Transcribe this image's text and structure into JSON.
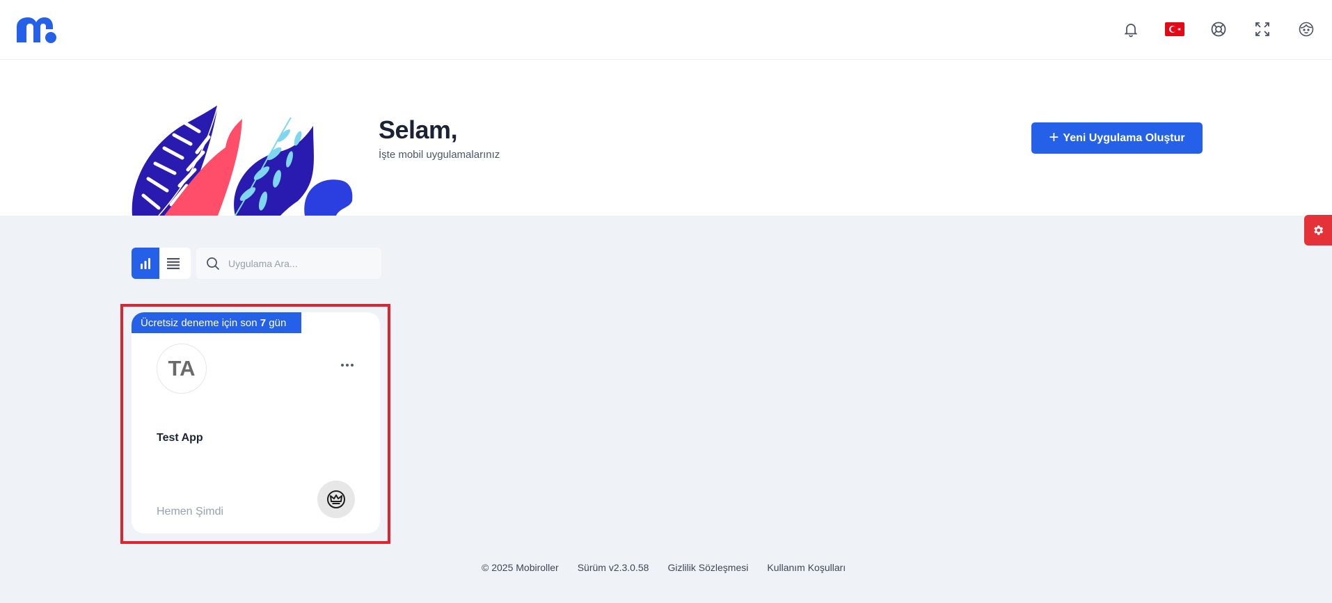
{
  "topbar": {
    "icons": [
      "bell-icon",
      "turkey-flag-icon",
      "help-lifebuoy-icon",
      "fullscreen-icon",
      "user-face-icon"
    ]
  },
  "hero": {
    "greeting": "Selam,",
    "subtitle": "İşte mobil uygulamalarınız",
    "new_app_button": "Yeni Uygulama Oluştur"
  },
  "toolbar": {
    "search_placeholder": "Uygulama Ara..."
  },
  "app_card": {
    "trial_prefix": "Ücretsiz deneme için son ",
    "trial_days": "7",
    "trial_suffix": " gün",
    "initials": "TA",
    "name": "Test App",
    "action_link": "Hemen Şimdi"
  },
  "footer": {
    "copyright": "© 2025 Mobiroller",
    "version": "Sürüm v2.3.0.58",
    "privacy": "Gizlilik Sözleşmesi",
    "terms": "Kullanım Koşulları"
  },
  "colors": {
    "brand_blue": "#2461e8",
    "settings_red": "#e53238",
    "highlight_red": "#e0232d",
    "background": "#eff2f7"
  }
}
